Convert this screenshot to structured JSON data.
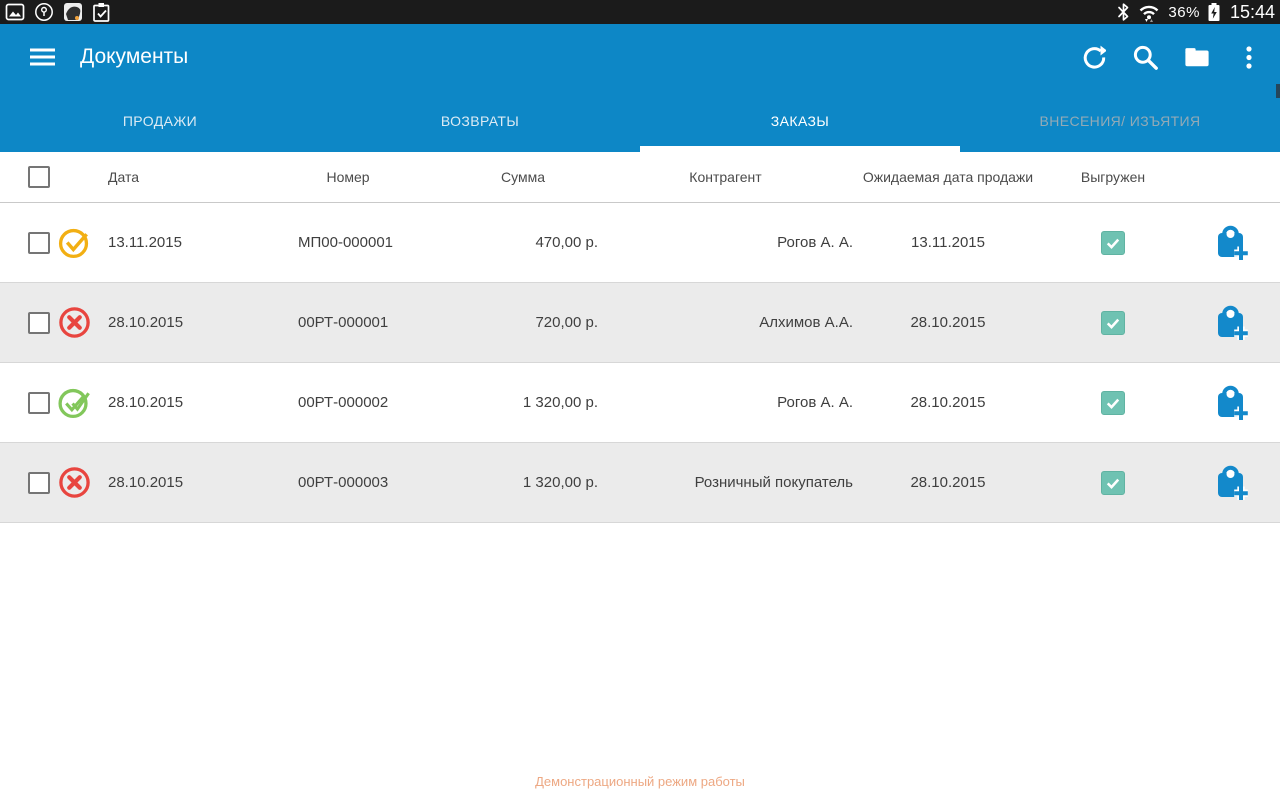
{
  "status_bar": {
    "time": "15:44",
    "battery_percent": "36%",
    "icons_left": [
      "image-icon",
      "pin-circle-icon",
      "app-thumbnail-icon",
      "clipboard-check-icon"
    ],
    "icons_right": [
      "bluetooth-icon",
      "wifi-icon",
      "battery-charging-icon"
    ]
  },
  "app_bar": {
    "title": "Документы",
    "actions": [
      "refresh-icon",
      "search-icon",
      "folder-icon",
      "overflow-menu-icon"
    ]
  },
  "tabs": [
    {
      "label": "ПРОДАЖИ",
      "selected": false
    },
    {
      "label": "ВОЗВРАТЫ",
      "selected": false
    },
    {
      "label": "ЗАКАЗЫ",
      "selected": true
    },
    {
      "label": "ВНЕСЕНИЯ/ ИЗЪЯТИЯ",
      "selected": false
    }
  ],
  "table": {
    "headers": {
      "date": "Дата",
      "number": "Номер",
      "sum": "Сумма",
      "counterparty": "Контрагент",
      "expected_date": "Ожидаемая дата продажи",
      "uploaded": "Выгружен"
    },
    "rows": [
      {
        "date": "13.11.2015",
        "number": "МП00-000001",
        "sum": "470,00 р.",
        "counterparty": "Рогов А. А.",
        "expected_date": "13.11.2015",
        "uploaded": true,
        "status_icon": "yellow-check-circle-icon",
        "status_class": "c-status st-warning"
      },
      {
        "date": "28.10.2015",
        "number": "00РТ-000001",
        "sum": "720,00 р.",
        "counterparty": "Алхимов А.А.",
        "expected_date": "28.10.2015",
        "uploaded": true,
        "status_icon": "red-cross-circle-icon",
        "status_class": "c-status st-error"
      },
      {
        "date": "28.10.2015",
        "number": "00РТ-000002",
        "sum": "1 320,00 р.",
        "counterparty": "Рогов А. А.",
        "expected_date": "28.10.2015",
        "uploaded": true,
        "status_icon": "green-double-check-circle-icon",
        "status_class": "c-status st-success"
      },
      {
        "date": "28.10.2015",
        "number": "00РТ-000003",
        "sum": "1 320,00 р.",
        "counterparty": "Розничный покупатель",
        "expected_date": "28.10.2015",
        "uploaded": true,
        "status_icon": "red-cross-circle-icon",
        "status_class": "c-status st-error"
      }
    ]
  },
  "footer": {
    "demo_mode_label": "Демонстрационный режим работы"
  },
  "colors": {
    "app_bar_blue": "#0d87c6",
    "row_alt_gray": "#ebebeb",
    "uploaded_check_teal": "#6fc2b2",
    "status_warning_yellow": "#f2af13",
    "status_error_red": "#e8453f",
    "status_success_green": "#82c75b",
    "bag_blue": "#1389cb",
    "demo_text_orange": "#eda883"
  }
}
